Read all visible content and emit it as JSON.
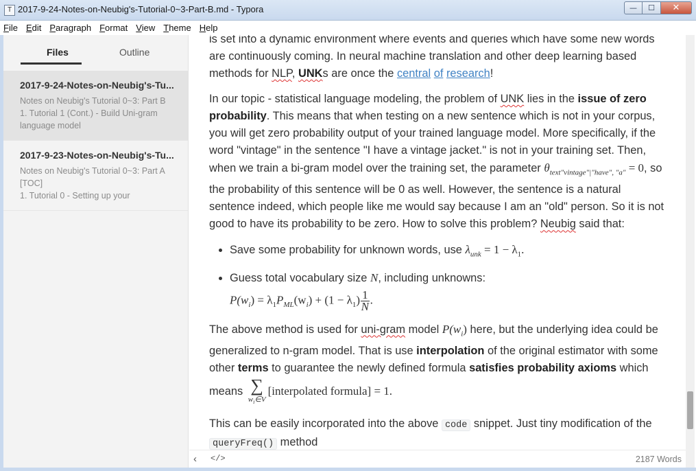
{
  "window": {
    "title": "2017-9-24-Notes-on-Neubig's-Tutorial-0~3-Part-B.md - Typora",
    "app_icon": "T",
    "min_glyph": "—",
    "max_glyph": "☐",
    "close_glyph": "✕"
  },
  "menu": [
    {
      "u": "F",
      "rest": "ile"
    },
    {
      "u": "E",
      "rest": "dit"
    },
    {
      "u": "P",
      "rest": "aragraph"
    },
    {
      "u": "F",
      "rest": "ormat"
    },
    {
      "u": "V",
      "rest": "iew"
    },
    {
      "u": "T",
      "rest": "heme"
    },
    {
      "u": "H",
      "rest": "elp"
    }
  ],
  "sidebar": {
    "tab_files": "Files",
    "tab_outline": "Outline",
    "files": [
      {
        "title": "2017-9-24-Notes-on-Neubig's-Tu...",
        "excerpt": [
          "Notes on Neubig's Tutorial 0~3: Part B",
          "1. Tutorial 1 (Cont.) - Build Uni-gram",
          "language model"
        ]
      },
      {
        "title": "2017-9-23-Notes-on-Neubig's-Tu...",
        "excerpt": [
          "Notes on Neubig's Tutorial 0~3: Part A",
          "[TOC]",
          "1. Tutorial 0 - Setting up your"
        ]
      }
    ]
  },
  "content": {
    "p1_a": "is set into a dynamic environment where events and queries which have some new words are continuously coming. In neural machine translation and other deep learning based methods for ",
    "p1_nlp": "NLP",
    "p1_comma": ", ",
    "p1_unk": "UNK",
    "p1_b": "s are once the ",
    "p1_link1": "central",
    "p1_link2": "of",
    "p1_link3": "research",
    "p1_end": "!",
    "p2_a": "In our topic - statistical language modeling, the problem of ",
    "p2_unk": "UNK",
    "p2_b": " lies in the ",
    "p2_bold": "issue of zero probability",
    "p2_c": ". This means that when testing on a new sentence which is not in your corpus, you will get zero probability output of your trained language model. More specifically, if the word \"vintage\" in the sentence \"I have a vintage jacket.\" is not in your training set. Then, when we train a bi-gram model over the training set, the parameter ",
    "p2_math": "θ",
    "p2_math_sub": "text\"vintage\"|\"have\", \"a\"",
    "p2_math_eq": " = 0",
    "p2_d": ", so the probability of this sentence will be 0 as well. However, the sentence is a natural sentence indeed, which people like me would say because I am an \"old\" person. So it is not good to have its probability to be zero. How to solve this problem? ",
    "p2_neubig": "Neubig",
    "p2_e": " said that:",
    "li1_text": "Save some probability for unknown words, use ",
    "li1_math_a": "λ",
    "li1_math_sub": "unk",
    "li1_math_b": " = 1 − λ",
    "li1_math_sub2": "1",
    "li1_math_end": ".",
    "li2_text": "Guess total vocabulary size ",
    "li2_N": "N",
    "li2_end": ", including unknowns:",
    "f_lhs": "P(w",
    "f_lhs_sub": "i",
    "f_eq": ") = λ",
    "f_l1": "1",
    "f_pml": "P",
    "f_pml_sub": "ML",
    "f_mid": "(w",
    "f_mid_sub": "i",
    "f_mid2": ") + (1 − λ",
    "f_l2": "1",
    "f_close": ")",
    "f_num": "1",
    "f_den": "N",
    "f_dot": ".",
    "p3_a": "The above method is used for ",
    "p3_unigram": "uni-gram",
    "p3_b": " model ",
    "p3_math": "P(w",
    "p3_math_sub": "i",
    "p3_math_end": ")",
    "p3_c": " here, but the underlying idea could be generalized to n-gram model. That is use ",
    "p3_bold1": "interpolation",
    "p3_d": " of the original estimator with some other ",
    "p3_bold2": "terms",
    "p3_e": " to guarantee the newly defined formula ",
    "p3_bold3": "satisfies probability axioms",
    "p3_f": " which means ",
    "p3_sum": "∑",
    "p3_sum_sub": "w",
    "p3_sum_sub_i": "i",
    "p3_sum_sub_rest": "∈V",
    "p3_formula": "[interpolated formula] = 1.",
    "p4_a": "This can be easily incorporated into the above ",
    "p4_code": "code",
    "p4_b": " snippet. Just tiny modification of the ",
    "p4_code2": "queryFreq()",
    "p4_c": " method"
  },
  "footer": {
    "back_icon": "‹",
    "source_icon": "</>",
    "word_count": "2187 Words"
  }
}
